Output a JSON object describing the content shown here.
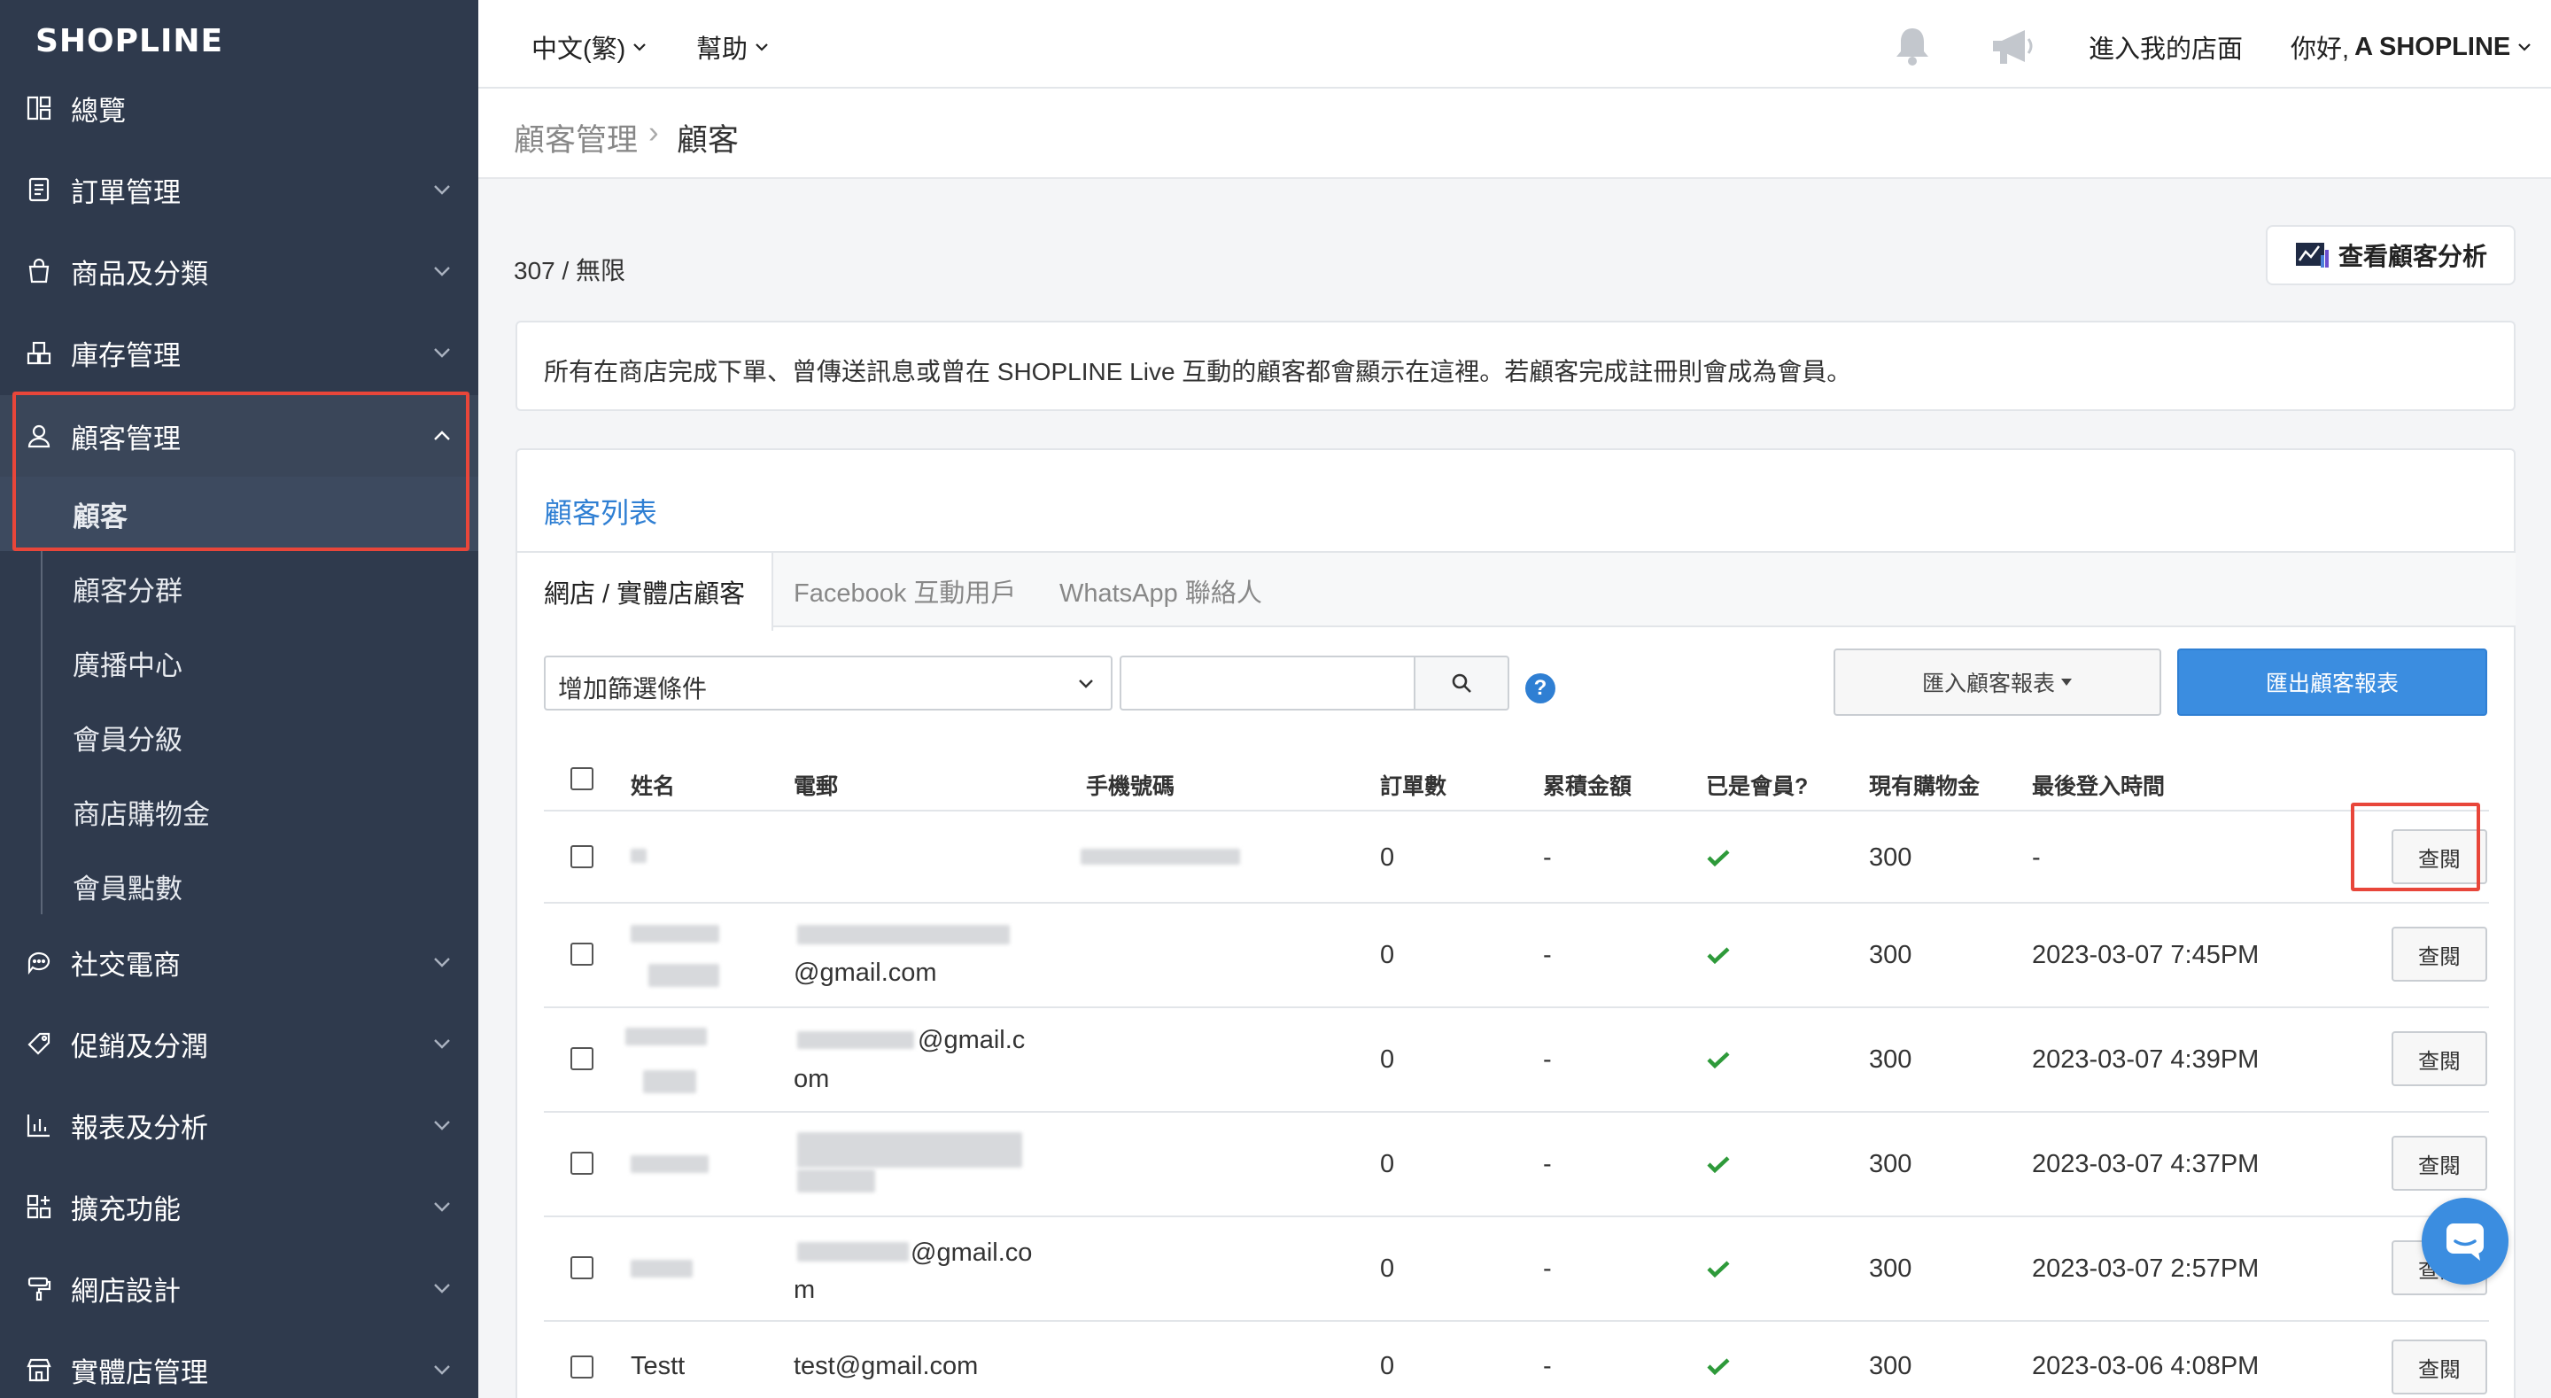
{
  "brand": {
    "logo": "SHOPLINE"
  },
  "sidebar": {
    "items": [
      {
        "label": "總覽",
        "icon": "dashboard-icon"
      },
      {
        "label": "訂單管理",
        "icon": "order-icon"
      },
      {
        "label": "商品及分類",
        "icon": "bag-icon"
      },
      {
        "label": "庫存管理",
        "icon": "inventory-icon"
      },
      {
        "label": "顧客管理",
        "icon": "user-icon"
      },
      {
        "label": "社交電商",
        "icon": "chat-bubble-icon"
      },
      {
        "label": "促銷及分潤",
        "icon": "tag-icon"
      },
      {
        "label": "報表及分析",
        "icon": "chart-icon"
      },
      {
        "label": "擴充功能",
        "icon": "apps-icon"
      },
      {
        "label": "網店設計",
        "icon": "paint-roller-icon"
      },
      {
        "label": "實體店管理",
        "icon": "store-icon"
      }
    ],
    "sub_items": [
      "顧客",
      "顧客分群",
      "廣播中心",
      "會員分級",
      "商店購物金",
      "會員點數"
    ]
  },
  "topbar": {
    "language": "中文(繁)",
    "help": "幫助",
    "enter_store": "進入我的店面",
    "greeting_prefix": "你好,",
    "greeting_name": "A SHOPLINE"
  },
  "breadcrumb": {
    "parent": "顧客管理",
    "separator": "›",
    "current": "顧客"
  },
  "count_text": "307 / 無限",
  "analysis_button": "查看顧客分析",
  "notice": "所有在商店完成下單、曾傳送訊息或曾在 SHOPLINE Live 互動的顧客都會顯示在這裡。若顧客完成註冊則會成為會員。",
  "list": {
    "title": "顧客列表",
    "tabs": [
      "網店 / 實體店顧客",
      "Facebook 互動用戶",
      "WhatsApp 聯絡人"
    ],
    "filter_placeholder": "增加篩選條件",
    "help_mark": "?",
    "import_button": "匯入顧客報表",
    "export_button": "匯出顧客報表",
    "columns": [
      "姓名",
      "電郵",
      "手機號碼",
      "訂單數",
      "累積金額",
      "已是會員?",
      "現有購物金",
      "最後登入時間"
    ],
    "rows": [
      {
        "name": "",
        "email_line1": "",
        "email_line2": "",
        "orders": "0",
        "amount": "-",
        "credit": "300",
        "last_login": "-",
        "action": "查閱"
      },
      {
        "name": "",
        "email_line1": "",
        "email_line2": "@gmail.com",
        "orders": "0",
        "amount": "-",
        "credit": "300",
        "last_login": "2023-03-07 7:45PM",
        "action": "查閱"
      },
      {
        "name": "",
        "email_line1": "@gmail.c",
        "email_line2": "om",
        "orders": "0",
        "amount": "-",
        "credit": "300",
        "last_login": "2023-03-07 4:39PM",
        "action": "查閱"
      },
      {
        "name": "",
        "email_line1": "",
        "email_line2": "",
        "orders": "0",
        "amount": "-",
        "credit": "300",
        "last_login": "2023-03-07 4:37PM",
        "action": "查閱"
      },
      {
        "name": "",
        "email_line1": "@gmail.co",
        "email_line2": "m",
        "orders": "0",
        "amount": "-",
        "credit": "300",
        "last_login": "2023-03-07 2:57PM",
        "action": "查閱"
      },
      {
        "name": "Testt",
        "email_line1": "test@gmail.com",
        "email_line2": "",
        "orders": "0",
        "amount": "-",
        "credit": "300",
        "last_login": "2023-03-06 4:08PM",
        "action": "查閱"
      }
    ]
  },
  "colors": {
    "sidebar": "#2f3a4d",
    "accent": "#2f7fd3",
    "highlight": "#e8463a",
    "check": "#2e9a3a"
  }
}
